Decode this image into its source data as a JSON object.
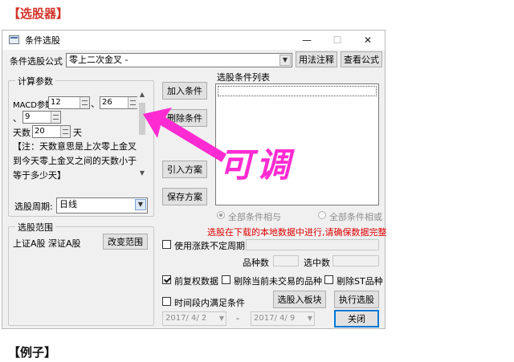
{
  "headings": {
    "top": "【选股器】",
    "bottom": "【例子】"
  },
  "window": {
    "title": "条件选股",
    "controls": {
      "minimize": "—",
      "maximize": "☐",
      "close": "✕"
    }
  },
  "formula": {
    "label": "条件选股公式",
    "selected": "零上二次金叉  -",
    "usage_button": "用法注释",
    "view_button": "查看公式"
  },
  "params": {
    "legend": "计算参数",
    "macd_label": "MACD参数",
    "sep1": "、",
    "macd_p1": "12",
    "macd_p2": "26",
    "sep2": "、",
    "macd_p3": "9",
    "days_label": "天数",
    "days_value": "20",
    "days_unit": "天",
    "note": "【注：天数意思是上次零上金叉到今天零上金叉之间的天数小于等于多少天】"
  },
  "period": {
    "label": "选股周期:",
    "value": "日线"
  },
  "range": {
    "legend": "选股范围",
    "markets": "上证A股 深证A股",
    "change_button": "改变范围"
  },
  "actions": {
    "add": "加入条件",
    "delete": "删除条件",
    "import": "引入方案",
    "save": "保存方案"
  },
  "conditions": {
    "label": "选股条件列表",
    "radio_and": "全部条件相与",
    "radio_or": "全部条件相或"
  },
  "warning": "选股在下载的本地数据中进行,请确保数据完整",
  "options": {
    "uncertain_label": "使用涨跌不定周期",
    "count_label": "品种数",
    "selected_label": "选中数",
    "fq_label": "前复权数据",
    "exclude_untraded": "剔除当前未交易的品种",
    "exclude_st": "剔除ST品种",
    "time_range_label": "时间段内满足条件",
    "date_from": "2017/ 4/ 2",
    "date_sep": "-",
    "date_to": "2017/ 4/ 9"
  },
  "buttons": {
    "to_block": "选股入板块",
    "run": "执行选股",
    "close": "关闭"
  },
  "annotation": {
    "text": "可调",
    "color": "#ff2bd2"
  },
  "colors": {
    "heading": "#d3342a",
    "warning": "#e00000",
    "annotation": "#ff2bd2"
  }
}
